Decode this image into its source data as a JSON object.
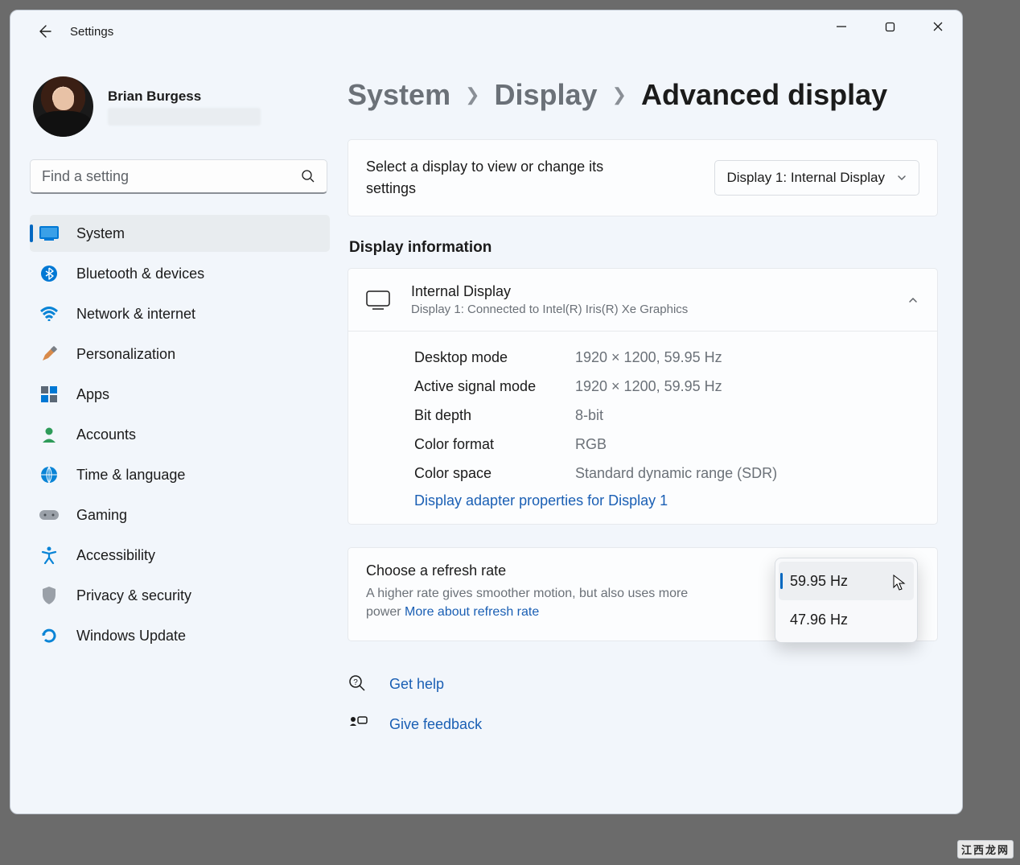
{
  "app_title": "Settings",
  "user": {
    "name": "Brian Burgess"
  },
  "search": {
    "placeholder": "Find a setting"
  },
  "sidebar": {
    "items": [
      {
        "label": "System",
        "icon": "system"
      },
      {
        "label": "Bluetooth & devices",
        "icon": "bluetooth"
      },
      {
        "label": "Network & internet",
        "icon": "wifi"
      },
      {
        "label": "Personalization",
        "icon": "brush"
      },
      {
        "label": "Apps",
        "icon": "apps"
      },
      {
        "label": "Accounts",
        "icon": "person"
      },
      {
        "label": "Time & language",
        "icon": "globe"
      },
      {
        "label": "Gaming",
        "icon": "gaming"
      },
      {
        "label": "Accessibility",
        "icon": "accessibility"
      },
      {
        "label": "Privacy & security",
        "icon": "shield"
      },
      {
        "label": "Windows Update",
        "icon": "update"
      }
    ]
  },
  "breadcrumb": {
    "level1": "System",
    "level2": "Display",
    "current": "Advanced display"
  },
  "select_display": {
    "prompt": "Select a display to view or change its settings",
    "selected": "Display 1: Internal Display"
  },
  "section_display_info": "Display information",
  "display_info": {
    "title": "Internal Display",
    "subtitle": "Display 1: Connected to Intel(R) Iris(R) Xe Graphics",
    "rows": {
      "desktop_mode": {
        "k": "Desktop mode",
        "v": "1920 × 1200, 59.95 Hz"
      },
      "active_signal": {
        "k": "Active signal mode",
        "v": "1920 × 1200, 59.95 Hz"
      },
      "bit_depth": {
        "k": "Bit depth",
        "v": "8-bit"
      },
      "color_format": {
        "k": "Color format",
        "v": "RGB"
      },
      "color_space": {
        "k": "Color space",
        "v": "Standard dynamic range (SDR)"
      }
    },
    "adapter_link": "Display adapter properties for Display 1"
  },
  "refresh": {
    "title": "Choose a refresh rate",
    "desc": "A higher rate gives smoother motion, but also uses more power  ",
    "more_link": "More about refresh rate",
    "options": [
      "59.95 Hz",
      "47.96 Hz"
    ],
    "selected_index": 0
  },
  "help": {
    "get_help": "Get help",
    "give_feedback": "Give feedback"
  },
  "watermark": "江西龙网"
}
